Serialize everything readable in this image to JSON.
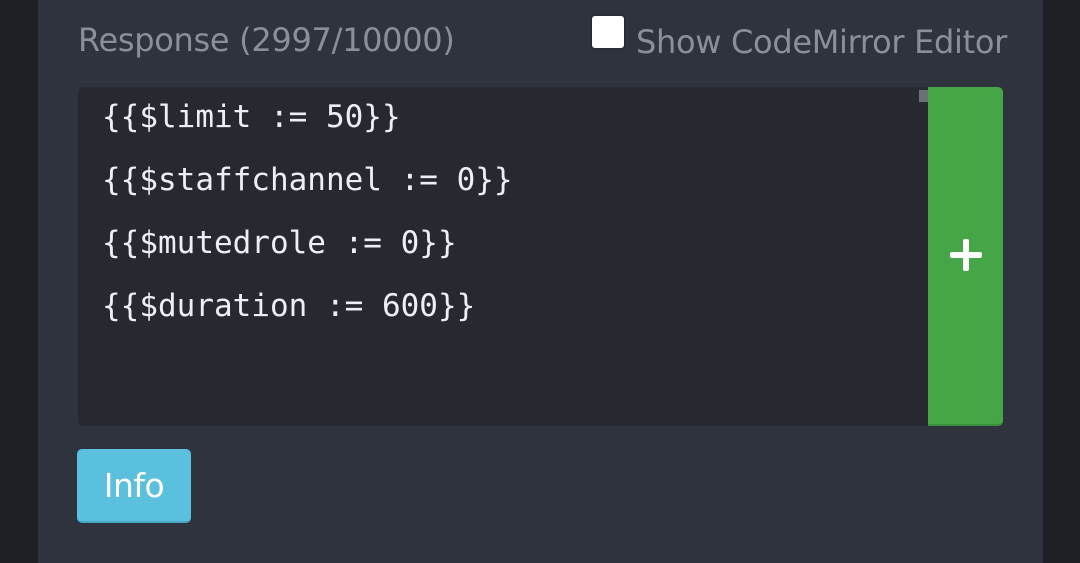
{
  "response": {
    "label": "Response (2997/10000)"
  },
  "codemirror_toggle": {
    "label": "Show CodeMirror Editor",
    "checked": false
  },
  "editor": {
    "lines": [
      "{{$limit := 50}}",
      "{{$staffchannel := 0}}",
      "{{$mutedrole := 0}}",
      "{{$duration := 600}}"
    ],
    "add_button_icon": "plus-icon"
  },
  "info_button": {
    "label": "Info"
  },
  "colors": {
    "add_button": "#46a546",
    "info_button": "#5bc0de",
    "panel": "#2e333d",
    "editor_bg": "#262930"
  }
}
